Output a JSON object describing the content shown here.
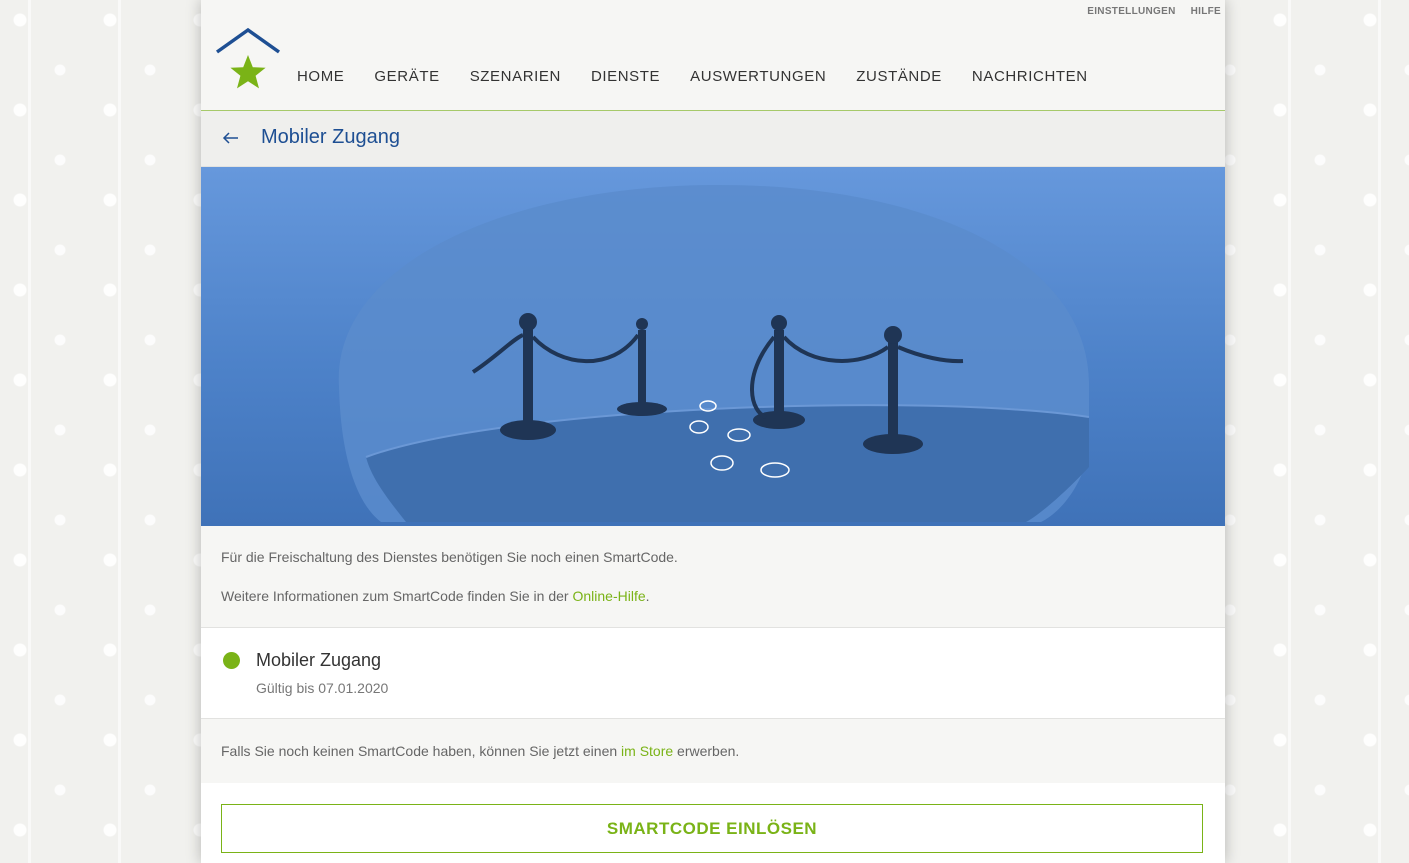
{
  "header": {
    "util_links": {
      "settings": "EINSTELLUNGEN",
      "help": "HILFE"
    },
    "nav": [
      {
        "label": "HOME"
      },
      {
        "label": "GERÄTE"
      },
      {
        "label": "SZENARIEN"
      },
      {
        "label": "DIENSTE"
      },
      {
        "label": "AUSWERTUNGEN"
      },
      {
        "label": "ZUSTÄNDE"
      },
      {
        "label": "NACHRICHTEN"
      }
    ]
  },
  "titlebar": {
    "title": "Mobiler Zugang"
  },
  "info": {
    "line1": "Für die Freischaltung des Dienstes benötigen Sie noch einen SmartCode.",
    "line2_prefix": "Weitere Informationen zum SmartCode finden Sie in der ",
    "line2_link": "Online-Hilfe",
    "line2_suffix": "."
  },
  "status": {
    "name": "Mobiler Zugang",
    "valid": "Gültig bis 07.01.2020",
    "indicator_color": "#7ab317"
  },
  "store": {
    "prefix": "Falls Sie noch keinen SmartCode haben, können Sie jetzt einen ",
    "link": "im Store",
    "suffix": " erwerben."
  },
  "actions": {
    "redeem_label": "SMARTCODE EINLÖSEN"
  },
  "colors": {
    "brand_blue": "#1e4f93",
    "accent_green": "#7ab317"
  }
}
